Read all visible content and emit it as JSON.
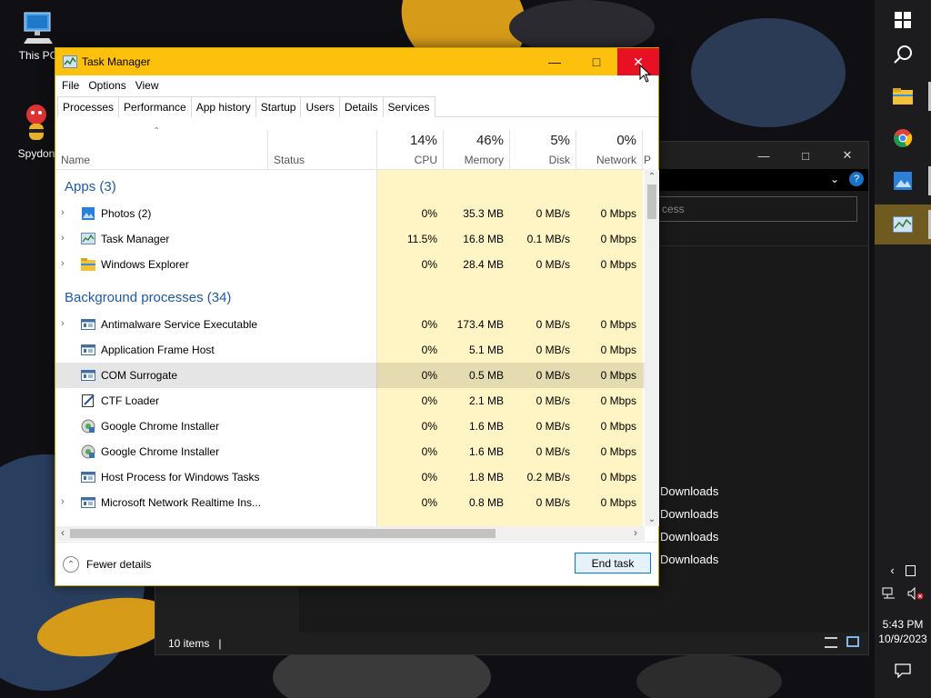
{
  "desktop": {
    "icons": [
      {
        "label": "This PC",
        "icon": "computer-icon"
      },
      {
        "label": "Spydon",
        "icon": "spydon-app-icon"
      }
    ]
  },
  "taskbar": {
    "apps": [
      {
        "name": "Start",
        "icon": "windows-logo-icon"
      },
      {
        "name": "Search",
        "icon": "search-icon"
      },
      {
        "name": "File Explorer",
        "icon": "folder-icon"
      },
      {
        "name": "Google Chrome",
        "icon": "chrome-icon"
      },
      {
        "name": "Photos",
        "icon": "photos-icon"
      },
      {
        "name": "Task Manager",
        "icon": "task-manager-icon"
      }
    ],
    "tray": {
      "chevron": "‹",
      "time": "5:43 PM",
      "date": "10/9/2023"
    }
  },
  "explorer": {
    "search_placeholder": "cess",
    "items": [
      "Downloads",
      "Downloads",
      "Downloads",
      "Downloads"
    ],
    "status": "10 items"
  },
  "taskmanager": {
    "title": "Task Manager",
    "menu": [
      "File",
      "Options",
      "View"
    ],
    "tabs": [
      "Processes",
      "Performance",
      "App history",
      "Startup",
      "Users",
      "Details",
      "Services"
    ],
    "selected_tab": "Processes",
    "columns": {
      "name": "Name",
      "status": "Status",
      "cpu": {
        "pct": "14%",
        "label": "CPU"
      },
      "memory": {
        "pct": "46%",
        "label": "Memory"
      },
      "disk": {
        "pct": "5%",
        "label": "Disk"
      },
      "network": {
        "pct": "0%",
        "label": "Network"
      },
      "cut": "P"
    },
    "groups": [
      {
        "title": "Apps (3)"
      },
      {
        "title": "Background processes (34)"
      }
    ],
    "processes": [
      {
        "name": "Photos (2)",
        "icon": "photos-icon",
        "expandable": true,
        "cpu": "0%",
        "memory": "35.3 MB",
        "disk": "0 MB/s",
        "network": "0 Mbps"
      },
      {
        "name": "Task Manager",
        "icon": "task-manager-icon",
        "expandable": true,
        "cpu": "11.5%",
        "memory": "16.8 MB",
        "disk": "0.1 MB/s",
        "network": "0 Mbps"
      },
      {
        "name": "Windows Explorer",
        "icon": "folder-icon",
        "expandable": true,
        "cpu": "0%",
        "memory": "28.4 MB",
        "disk": "0 MB/s",
        "network": "0 Mbps"
      },
      {
        "name": "Antimalware Service Executable",
        "icon": "service-icon",
        "expandable": true,
        "cpu": "0%",
        "memory": "173.4 MB",
        "disk": "0 MB/s",
        "network": "0 Mbps"
      },
      {
        "name": "Application Frame Host",
        "icon": "service-icon",
        "expandable": false,
        "cpu": "0%",
        "memory": "5.1 MB",
        "disk": "0 MB/s",
        "network": "0 Mbps"
      },
      {
        "name": "COM Surrogate",
        "icon": "service-icon",
        "expandable": false,
        "cpu": "0%",
        "memory": "0.5 MB",
        "disk": "0 MB/s",
        "network": "0 Mbps"
      },
      {
        "name": "CTF Loader",
        "icon": "ctf-loader-icon",
        "expandable": false,
        "cpu": "0%",
        "memory": "2.1 MB",
        "disk": "0 MB/s",
        "network": "0 Mbps"
      },
      {
        "name": "Google Chrome Installer",
        "icon": "installer-icon",
        "expandable": false,
        "cpu": "0%",
        "memory": "1.6 MB",
        "disk": "0 MB/s",
        "network": "0 Mbps"
      },
      {
        "name": "Google Chrome Installer",
        "icon": "installer-icon",
        "expandable": false,
        "cpu": "0%",
        "memory": "1.6 MB",
        "disk": "0 MB/s",
        "network": "0 Mbps"
      },
      {
        "name": "Host Process for Windows Tasks",
        "icon": "service-icon",
        "expandable": false,
        "cpu": "0%",
        "memory": "1.8 MB",
        "disk": "0.2 MB/s",
        "network": "0 Mbps"
      },
      {
        "name": "Microsoft Network Realtime Ins...",
        "icon": "service-icon",
        "expandable": true,
        "cpu": "0%",
        "memory": "0.8 MB",
        "disk": "0 MB/s",
        "network": "0 Mbps"
      }
    ],
    "fewer_details": "Fewer details",
    "end_task": "End task"
  }
}
